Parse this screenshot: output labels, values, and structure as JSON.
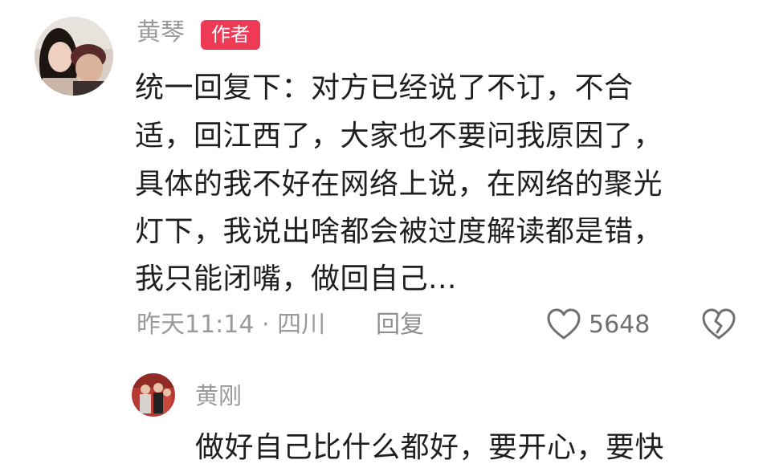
{
  "comment": {
    "author": "黄琴",
    "badge": "作者",
    "lines": [
      "统一回复下：对方已经说了不订，不合",
      "适，回江西了，大家也不要问我原因了，",
      "具体的我不好在网络上说，在网络的聚光",
      "灯下，我说出啥都会被过度解读都是错，",
      "我只能闭嘴，做回自己..."
    ],
    "meta": "昨天11:14 · 四川",
    "reply_label": "回复",
    "like_count": "5648",
    "icons": {
      "like": "heart-outline-icon",
      "dislike": "broken-heart-icon"
    }
  },
  "reply": {
    "author": "黄刚",
    "text": "做好自己比什么都好，要开心，要快"
  },
  "colors": {
    "badge": "#ee3a55",
    "meta_text": "#9a9a9a",
    "body_text": "#1f1f1f"
  }
}
